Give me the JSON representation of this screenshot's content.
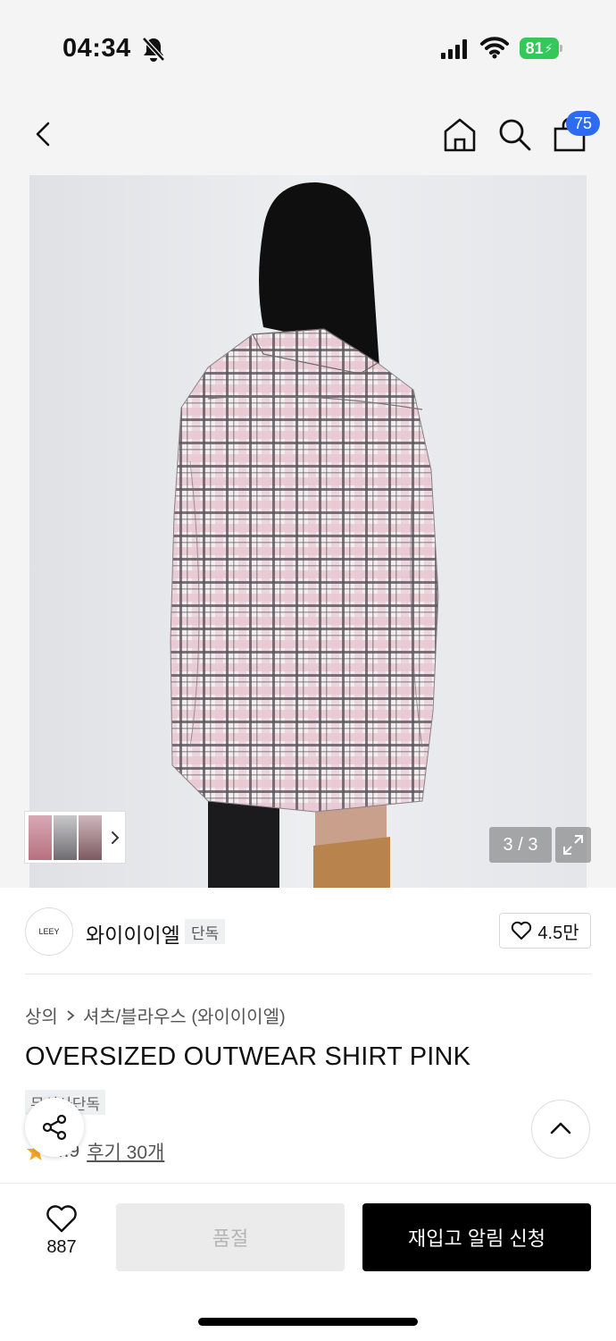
{
  "status_bar": {
    "time": "04:34",
    "battery": "81",
    "icons": [
      "bell-off-icon",
      "signal-icon",
      "wifi-icon",
      "battery-charging-icon"
    ]
  },
  "nav": {
    "icons": [
      "back-icon",
      "home-icon",
      "search-icon",
      "shopping-bag-icon"
    ],
    "cart_badge": "75"
  },
  "gallery": {
    "counter": "3 / 3",
    "expand_icon": "expand-icon",
    "thumbnail_arrow_icon": "chevron-right-icon",
    "colors": {
      "background": "#e3e5e8",
      "check_pink": "#e8c6d0",
      "check_dark": "#5b5357"
    }
  },
  "brand": {
    "logo_text": "LEEY",
    "name": "와이이이엘",
    "exclusive_tag": "단독",
    "like_count": "4.5만"
  },
  "breadcrumb": {
    "category": "상의",
    "subcategory": "셔츠/블라우스 (와이이이엘)"
  },
  "product": {
    "title": "OVERSIZED OUTWEAR SHIRT PINK",
    "tag": "무신사단독",
    "rating_score": "4.9",
    "review_label": "후기 30개"
  },
  "bottom_bar": {
    "wish_count": "887",
    "soldout_label": "품절",
    "restock_label": "재입고 알림 신청"
  },
  "colors": {
    "accent_blue": "#2f6bf2",
    "battery_green": "#34c759",
    "star_orange": "#f5a623",
    "primary_black": "#000000"
  }
}
